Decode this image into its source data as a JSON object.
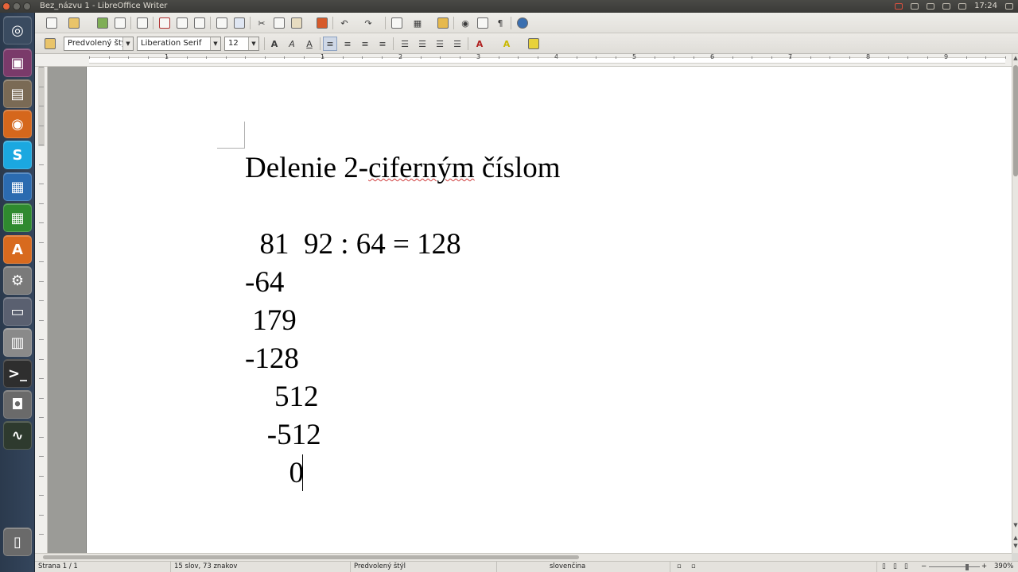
{
  "window": {
    "title": "Bez_názvu 1 - LibreOffice Writer",
    "clock": "17:24"
  },
  "launcher": {
    "items": [
      {
        "name": "dash-home",
        "glyph": "◎",
        "color": "#3a4b60"
      },
      {
        "name": "display-settings",
        "glyph": "▣",
        "color": "#7a3a6a"
      },
      {
        "name": "file-manager",
        "glyph": "▤",
        "color": "#7a6a55"
      },
      {
        "name": "firefox",
        "glyph": "◉",
        "color": "#d5671c"
      },
      {
        "name": "skype",
        "glyph": "S",
        "color": "#1ba8e0"
      },
      {
        "name": "writer",
        "glyph": "▦",
        "color": "#2b6bb0"
      },
      {
        "name": "calc",
        "glyph": "▦",
        "color": "#2f8a2f"
      },
      {
        "name": "software-center",
        "glyph": "A",
        "color": "#d86a1e"
      },
      {
        "name": "system-settings",
        "glyph": "⚙",
        "color": "#7a7a7a"
      },
      {
        "name": "workspace-switcher",
        "glyph": "▭",
        "color": "#5a6070"
      },
      {
        "name": "calculator",
        "glyph": "▥",
        "color": "#8a8a8a"
      },
      {
        "name": "terminal",
        "glyph": ">_",
        "color": "#2e2e2e"
      },
      {
        "name": "screenshot",
        "glyph": "◘",
        "color": "#6a6a6a"
      },
      {
        "name": "system-monitor",
        "glyph": "∿",
        "color": "#2e3a2e"
      },
      {
        "name": "trash",
        "glyph": "▯",
        "color": "#6a6a6a"
      }
    ]
  },
  "formatting": {
    "paragraph_style": "Predvolený štýl",
    "font_name": "Liberation Serif",
    "font_size": "12"
  },
  "document": {
    "title_before": "Delenie 2-",
    "title_misspelled": "ciferným",
    "title_after": " číslom",
    "lines": [
      "  81  92 : 64 = 128",
      "-64",
      " 179",
      "-128",
      "    512",
      "   -512",
      "      0"
    ]
  },
  "ruler": {
    "numbers": [
      "1",
      "1",
      "2",
      "3",
      "4",
      "5",
      "6",
      "7",
      "8",
      "9"
    ]
  },
  "statusbar": {
    "page": "Strana 1 / 1",
    "words": "15 slov, 73 znakov",
    "style": "Predvolený štýl",
    "language": "slovenčina",
    "zoom": "390%"
  }
}
